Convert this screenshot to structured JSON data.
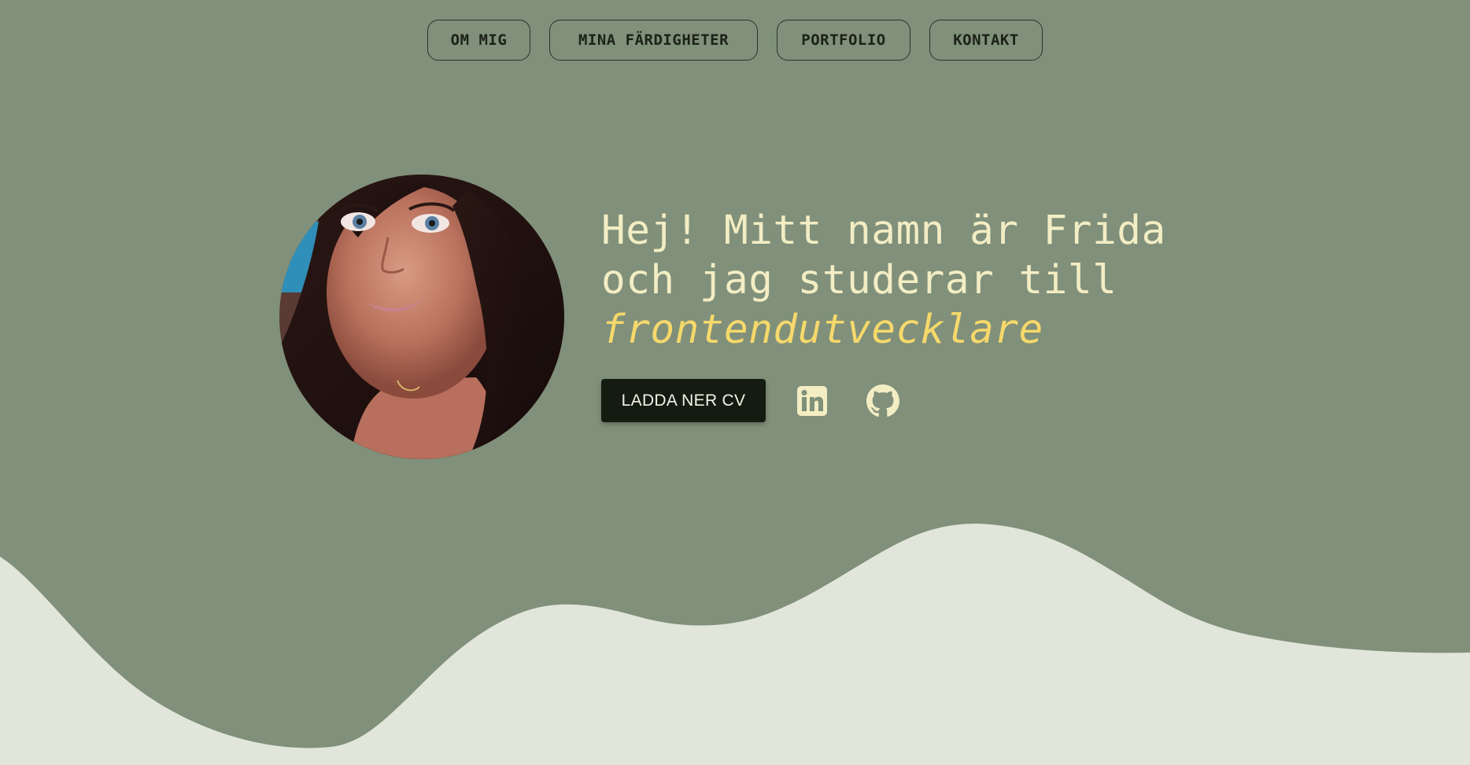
{
  "nav": {
    "items": [
      {
        "label": "OM MIG"
      },
      {
        "label": "MINA FÄRDIGHETER"
      },
      {
        "label": "PORTFOLIO"
      },
      {
        "label": "KONTAKT"
      }
    ]
  },
  "hero": {
    "avatar_alt": "avatar",
    "headline_line1": "Hej! Mitt namn är Frida",
    "headline_line2": "och jag studerar till",
    "headline_accent": "frontendutvecklare",
    "cv_button_label": "LADDA NER CV",
    "social_icons": [
      "linkedin-icon",
      "github-icon"
    ]
  },
  "colors": {
    "background_green": "#80907a",
    "background_light": "#e2e5da",
    "headline_text": "#f3edc4",
    "accent_text": "#f6d86b",
    "cv_button_bg": "#141c12",
    "icon_color": "#f3edc4"
  }
}
